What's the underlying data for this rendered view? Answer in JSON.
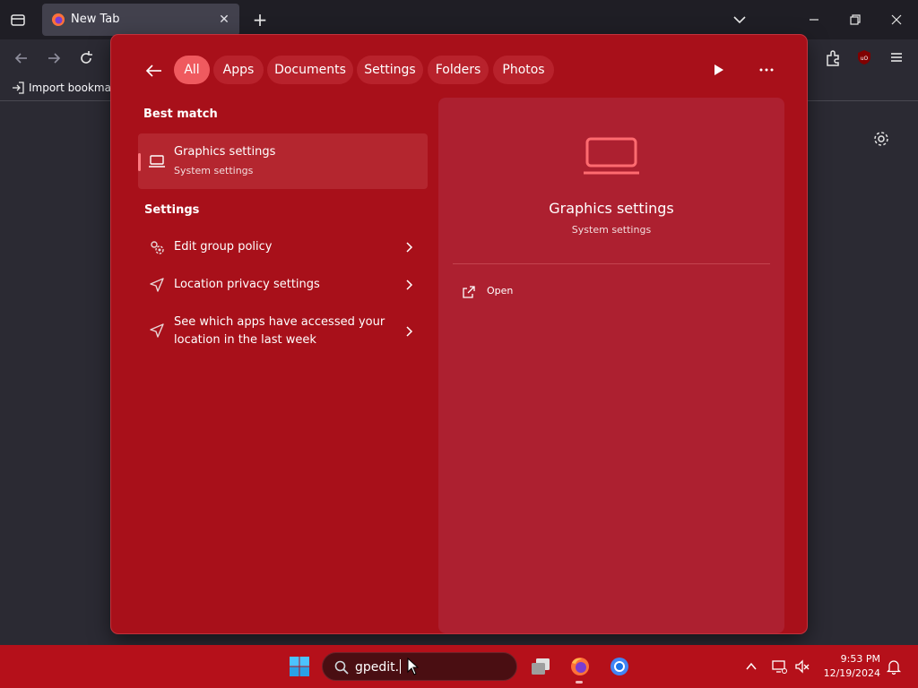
{
  "browser": {
    "tab_title": "New Tab",
    "bookmark_import_label": "Import bookmarks...",
    "icons": [
      "tabs-menu-icon",
      "firefox-icon",
      "close-icon",
      "plus-icon",
      "chevron-down-icon",
      "minimize-icon",
      "restore-icon",
      "window-close-icon",
      "back-icon",
      "forward-icon",
      "reload-icon",
      "extensions-icon",
      "ublock-icon",
      "hamburger-menu-icon",
      "import-icon",
      "gear-icon"
    ]
  },
  "search_panel": {
    "filters": [
      "All",
      "Apps",
      "Documents",
      "Settings",
      "Folders",
      "Photos"
    ],
    "active_filter": "All",
    "best_match": {
      "section_title": "Best match",
      "title": "Graphics settings",
      "subtitle": "System settings"
    },
    "settings": {
      "section_title": "Settings",
      "items": [
        {
          "label": "Edit group policy",
          "icon": "group-policy-icon"
        },
        {
          "label": "Location privacy settings",
          "icon": "location-icon"
        },
        {
          "label": "See which apps have accessed your location in the last week",
          "icon": "location-icon"
        }
      ]
    },
    "detail": {
      "title": "Graphics settings",
      "subtitle": "System settings",
      "actions": [
        {
          "label": "Open",
          "icon": "open-external-icon"
        }
      ]
    },
    "colors": {
      "panel": "#a8101a",
      "active_chip": "#ef5a5f",
      "accent_icon": "#ff6b70"
    }
  },
  "taskbar": {
    "search_text": "gpedit.",
    "time": "9:53 PM",
    "date": "12/19/2024",
    "color": "#b5101a"
  }
}
